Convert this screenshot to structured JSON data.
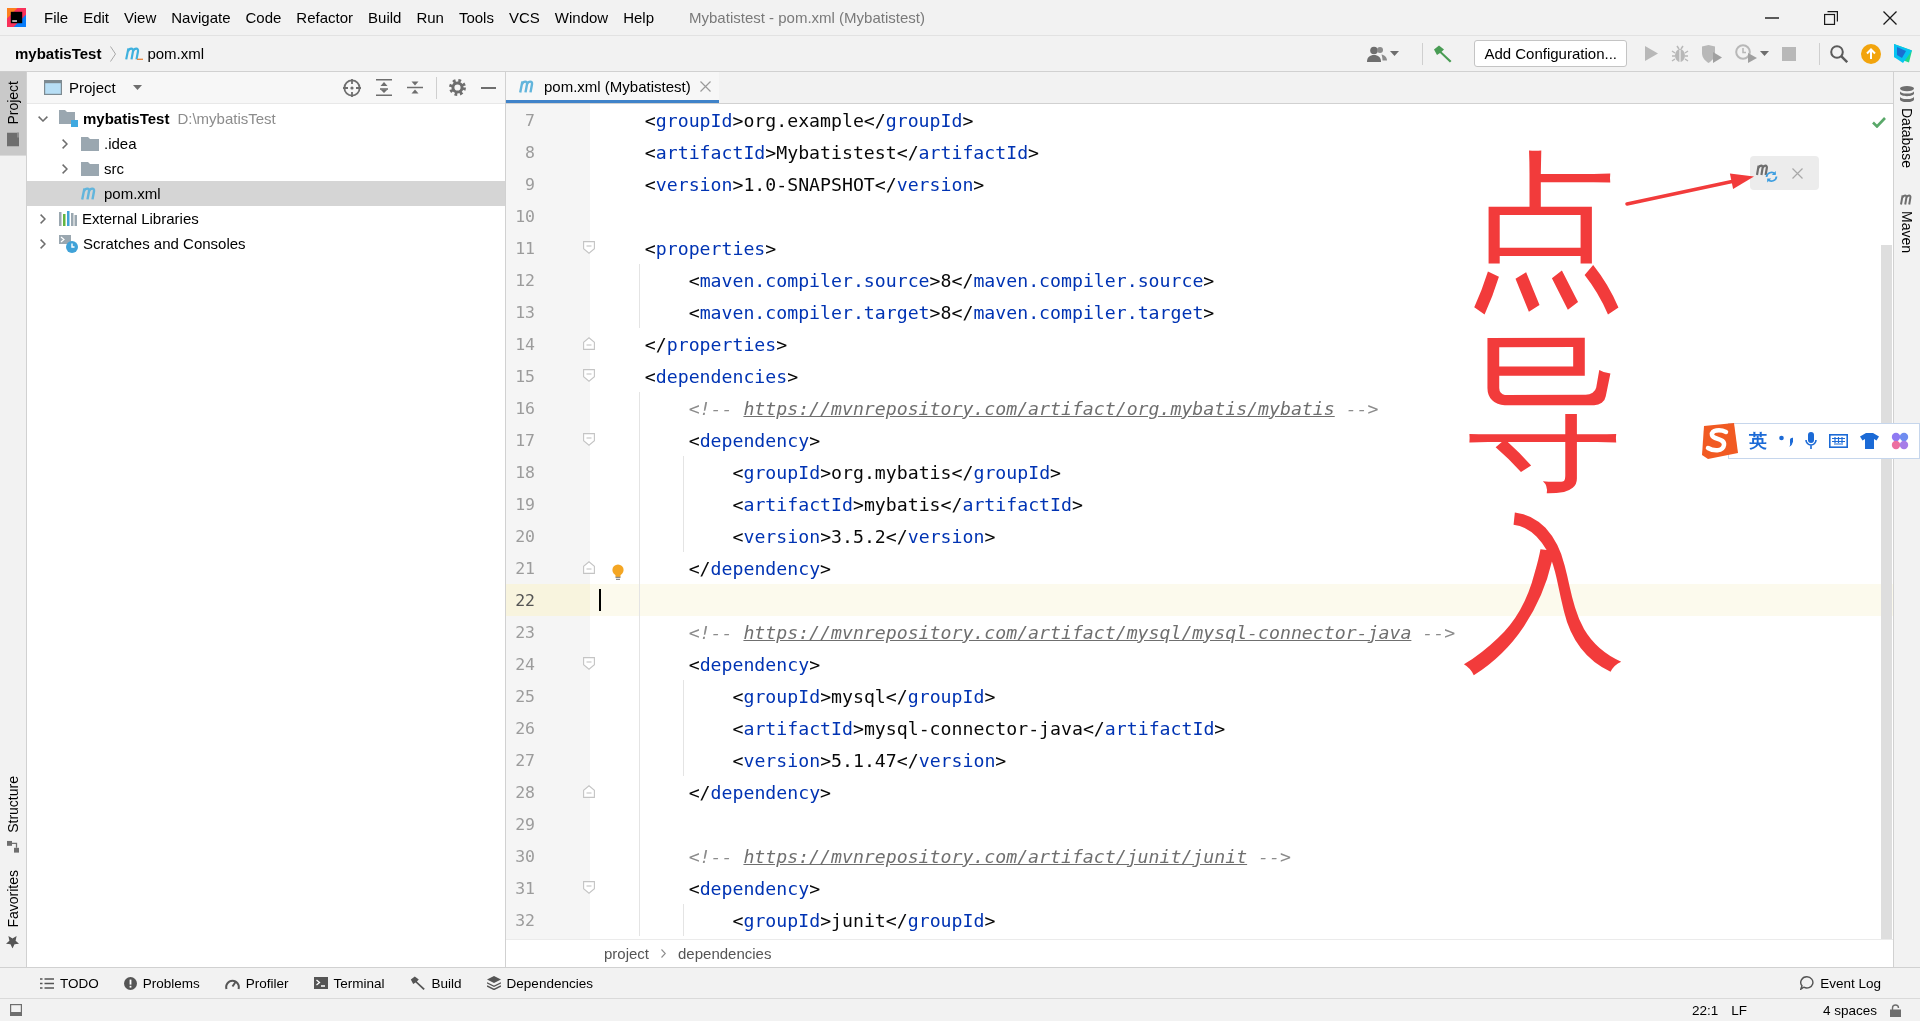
{
  "window": {
    "title": "Mybatistest - pom.xml (Mybatistest)"
  },
  "menu": [
    "File",
    "Edit",
    "View",
    "Navigate",
    "Code",
    "Refactor",
    "Build",
    "Run",
    "Tools",
    "VCS",
    "Window",
    "Help"
  ],
  "navbar": {
    "breadcrumb": [
      {
        "label": "mybatisTest",
        "kind": "project"
      },
      {
        "label": "pom.xml",
        "kind": "maven"
      }
    ],
    "run_configuration": "Add Configuration..."
  },
  "left_toolbar": {
    "top": [
      {
        "label": "Project",
        "kind": "project",
        "selected": true
      }
    ],
    "bottom": [
      {
        "label": "Structure",
        "kind": "structure",
        "selected": false
      },
      {
        "label": "Favorites",
        "kind": "favorites",
        "selected": false
      }
    ]
  },
  "project_panel": {
    "title": "Project",
    "tree": [
      {
        "label": "mybatisTest",
        "path": "D:\\mybatisTest",
        "kind": "module",
        "expanded": true,
        "selected": false,
        "children": [
          {
            "label": ".idea",
            "kind": "folder",
            "expanded": false,
            "selected": false
          },
          {
            "label": "src",
            "kind": "folder",
            "expanded": false,
            "selected": false
          },
          {
            "label": "pom.xml",
            "kind": "maven-file",
            "selected": true
          }
        ]
      },
      {
        "label": "External Libraries",
        "kind": "libraries",
        "expanded": false,
        "selected": false
      },
      {
        "label": "Scratches and Consoles",
        "kind": "scratches",
        "expanded": false,
        "selected": false
      }
    ]
  },
  "editor": {
    "tabs": [
      {
        "label": "pom.xml (Mybatistest)",
        "selected": true
      }
    ],
    "lines": [
      {
        "number": "7",
        "current": false,
        "bulb": false,
        "fold_start": false,
        "fold_end": false,
        "tokens": [
          {
            "kind": "plain",
            "text": "    <"
          },
          {
            "kind": "tag",
            "text": "groupId"
          },
          {
            "kind": "plain",
            "text": ">org.example</"
          },
          {
            "kind": "tag",
            "text": "groupId"
          },
          {
            "kind": "plain",
            "text": ">"
          }
        ]
      },
      {
        "number": "8",
        "current": false,
        "bulb": false,
        "fold_start": false,
        "fold_end": false,
        "tokens": [
          {
            "kind": "plain",
            "text": "    <"
          },
          {
            "kind": "tag",
            "text": "artifactId"
          },
          {
            "kind": "plain",
            "text": ">Mybatistest</"
          },
          {
            "kind": "tag",
            "text": "artifactId"
          },
          {
            "kind": "plain",
            "text": ">"
          }
        ]
      },
      {
        "number": "9",
        "current": false,
        "bulb": false,
        "fold_start": false,
        "fold_end": false,
        "tokens": [
          {
            "kind": "plain",
            "text": "    <"
          },
          {
            "kind": "tag",
            "text": "version"
          },
          {
            "kind": "plain",
            "text": ">1.0-SNAPSHOT</"
          },
          {
            "kind": "tag",
            "text": "version"
          },
          {
            "kind": "plain",
            "text": ">"
          }
        ]
      },
      {
        "number": "10",
        "current": false,
        "bulb": false,
        "fold_start": false,
        "fold_end": false
      },
      {
        "number": "11",
        "current": false,
        "bulb": false,
        "fold_start": true,
        "fold_end": false,
        "tokens": [
          {
            "kind": "plain",
            "text": "    <"
          },
          {
            "kind": "tag",
            "text": "properties"
          },
          {
            "kind": "plain",
            "text": ">"
          }
        ]
      },
      {
        "number": "12",
        "current": false,
        "bulb": false,
        "fold_start": false,
        "fold_end": false,
        "tokens": [
          {
            "kind": "plain",
            "text": "        <"
          },
          {
            "kind": "tag",
            "text": "maven.compiler.source"
          },
          {
            "kind": "plain",
            "text": ">8</"
          },
          {
            "kind": "tag",
            "text": "maven.compiler.source"
          },
          {
            "kind": "plain",
            "text": ">"
          }
        ]
      },
      {
        "number": "13",
        "current": false,
        "bulb": false,
        "fold_start": false,
        "fold_end": false,
        "tokens": [
          {
            "kind": "plain",
            "text": "        <"
          },
          {
            "kind": "tag",
            "text": "maven.compiler.target"
          },
          {
            "kind": "plain",
            "text": ">8</"
          },
          {
            "kind": "tag",
            "text": "maven.compiler.target"
          },
          {
            "kind": "plain",
            "text": ">"
          }
        ]
      },
      {
        "number": "14",
        "current": false,
        "bulb": false,
        "fold_start": false,
        "fold_end": true,
        "tokens": [
          {
            "kind": "plain",
            "text": "    </"
          },
          {
            "kind": "tag",
            "text": "properties"
          },
          {
            "kind": "plain",
            "text": ">"
          }
        ]
      },
      {
        "number": "15",
        "current": false,
        "bulb": false,
        "fold_start": true,
        "fold_end": false,
        "tokens": [
          {
            "kind": "plain",
            "text": "    <"
          },
          {
            "kind": "tag",
            "text": "dependencies"
          },
          {
            "kind": "plain",
            "text": ">"
          }
        ]
      },
      {
        "number": "16",
        "current": false,
        "bulb": false,
        "fold_start": false,
        "fold_end": false,
        "tokens": [
          {
            "kind": "comment",
            "text": "        <!-- "
          },
          {
            "kind": "link",
            "text": "https://mvnrepository.com/artifact/org.mybatis/mybatis"
          },
          {
            "kind": "comment",
            "text": " -->"
          }
        ]
      },
      {
        "number": "17",
        "current": false,
        "bulb": false,
        "fold_start": true,
        "fold_end": false,
        "tokens": [
          {
            "kind": "plain",
            "text": "        <"
          },
          {
            "kind": "tag",
            "text": "dependency"
          },
          {
            "kind": "plain",
            "text": ">"
          }
        ]
      },
      {
        "number": "18",
        "current": false,
        "bulb": false,
        "fold_start": false,
        "fold_end": false,
        "tokens": [
          {
            "kind": "plain",
            "text": "            <"
          },
          {
            "kind": "tag",
            "text": "groupId"
          },
          {
            "kind": "plain",
            "text": ">org.mybatis</"
          },
          {
            "kind": "tag",
            "text": "groupId"
          },
          {
            "kind": "plain",
            "text": ">"
          }
        ]
      },
      {
        "number": "19",
        "current": false,
        "bulb": false,
        "fold_start": false,
        "fold_end": false,
        "tokens": [
          {
            "kind": "plain",
            "text": "            <"
          },
          {
            "kind": "tag",
            "text": "artifactId"
          },
          {
            "kind": "plain",
            "text": ">mybatis</"
          },
          {
            "kind": "tag",
            "text": "artifactId"
          },
          {
            "kind": "plain",
            "text": ">"
          }
        ]
      },
      {
        "number": "20",
        "current": false,
        "bulb": false,
        "fold_start": false,
        "fold_end": false,
        "tokens": [
          {
            "kind": "plain",
            "text": "            <"
          },
          {
            "kind": "tag",
            "text": "version"
          },
          {
            "kind": "plain",
            "text": ">3.5.2</"
          },
          {
            "kind": "tag",
            "text": "version"
          },
          {
            "kind": "plain",
            "text": ">"
          }
        ]
      },
      {
        "number": "21",
        "current": false,
        "bulb": true,
        "fold_start": false,
        "fold_end": true,
        "tokens": [
          {
            "kind": "plain",
            "text": "        </"
          },
          {
            "kind": "tag",
            "text": "dependency"
          },
          {
            "kind": "plain",
            "text": ">"
          }
        ]
      },
      {
        "number": "22",
        "current": true,
        "bulb": false,
        "fold_start": false,
        "fold_end": false
      },
      {
        "number": "23",
        "current": false,
        "bulb": false,
        "fold_start": false,
        "fold_end": false,
        "tokens": [
          {
            "kind": "comment",
            "text": "        <!-- "
          },
          {
            "kind": "link",
            "text": "https://mvnrepository.com/artifact/mysql/mysql-connector-java"
          },
          {
            "kind": "comment",
            "text": " -->"
          }
        ]
      },
      {
        "number": "24",
        "current": false,
        "bulb": false,
        "fold_start": true,
        "fold_end": false,
        "tokens": [
          {
            "kind": "plain",
            "text": "        <"
          },
          {
            "kind": "tag",
            "text": "dependency"
          },
          {
            "kind": "plain",
            "text": ">"
          }
        ]
      },
      {
        "number": "25",
        "current": false,
        "bulb": false,
        "fold_start": false,
        "fold_end": false,
        "tokens": [
          {
            "kind": "plain",
            "text": "            <"
          },
          {
            "kind": "tag",
            "text": "groupId"
          },
          {
            "kind": "plain",
            "text": ">mysql</"
          },
          {
            "kind": "tag",
            "text": "groupId"
          },
          {
            "kind": "plain",
            "text": ">"
          }
        ]
      },
      {
        "number": "26",
        "current": false,
        "bulb": false,
        "fold_start": false,
        "fold_end": false,
        "tokens": [
          {
            "kind": "plain",
            "text": "            <"
          },
          {
            "kind": "tag",
            "text": "artifactId"
          },
          {
            "kind": "plain",
            "text": ">mysql-connector-java</"
          },
          {
            "kind": "tag",
            "text": "artifactId"
          },
          {
            "kind": "plain",
            "text": ">"
          }
        ]
      },
      {
        "number": "27",
        "current": false,
        "bulb": false,
        "fold_start": false,
        "fold_end": false,
        "tokens": [
          {
            "kind": "plain",
            "text": "            <"
          },
          {
            "kind": "tag",
            "text": "version"
          },
          {
            "kind": "plain",
            "text": ">5.1.47</"
          },
          {
            "kind": "tag",
            "text": "version"
          },
          {
            "kind": "plain",
            "text": ">"
          }
        ]
      },
      {
        "number": "28",
        "current": false,
        "bulb": false,
        "fold_start": false,
        "fold_end": true,
        "tokens": [
          {
            "kind": "plain",
            "text": "        </"
          },
          {
            "kind": "tag",
            "text": "dependency"
          },
          {
            "kind": "plain",
            "text": ">"
          }
        ]
      },
      {
        "number": "29",
        "current": false,
        "bulb": false,
        "fold_start": false,
        "fold_end": false
      },
      {
        "number": "30",
        "current": false,
        "bulb": false,
        "fold_start": false,
        "fold_end": false,
        "tokens": [
          {
            "kind": "comment",
            "text": "        <!-- "
          },
          {
            "kind": "link",
            "text": "https://mvnrepository.com/artifact/junit/junit"
          },
          {
            "kind": "comment",
            "text": " -->"
          }
        ]
      },
      {
        "number": "31",
        "current": false,
        "bulb": false,
        "fold_start": true,
        "fold_end": false,
        "tokens": [
          {
            "kind": "plain",
            "text": "        <"
          },
          {
            "kind": "tag",
            "text": "dependency"
          },
          {
            "kind": "plain",
            "text": ">"
          }
        ]
      },
      {
        "number": "32",
        "current": false,
        "bulb": false,
        "fold_start": false,
        "fold_end": false,
        "tokens": [
          {
            "kind": "plain",
            "text": "            <"
          },
          {
            "kind": "tag",
            "text": "groupId"
          },
          {
            "kind": "plain",
            "text": ">junit</"
          },
          {
            "kind": "tag",
            "text": "groupId"
          },
          {
            "kind": "plain",
            "text": ">"
          }
        ]
      }
    ],
    "breadcrumb": [
      "project",
      "dependencies"
    ]
  },
  "right_toolbar": [
    {
      "label": "Database",
      "kind": "database"
    },
    {
      "label": "Maven",
      "kind": "maven"
    }
  ],
  "tool_windows": [
    {
      "label": "TODO",
      "kind": "todo"
    },
    {
      "label": "Problems",
      "kind": "problems"
    },
    {
      "label": "Profiler",
      "kind": "profiler"
    },
    {
      "label": "Terminal",
      "kind": "terminal"
    },
    {
      "label": "Build",
      "kind": "build"
    },
    {
      "label": "Dependencies",
      "kind": "dependencies"
    }
  ],
  "event_log": "Event Log",
  "status_bar": {
    "position": "22:1",
    "line_separator": "LF",
    "indent": "4 spaces"
  },
  "ime_toolbar": {
    "mode": "英"
  },
  "annotation": {
    "text": "点导入"
  }
}
